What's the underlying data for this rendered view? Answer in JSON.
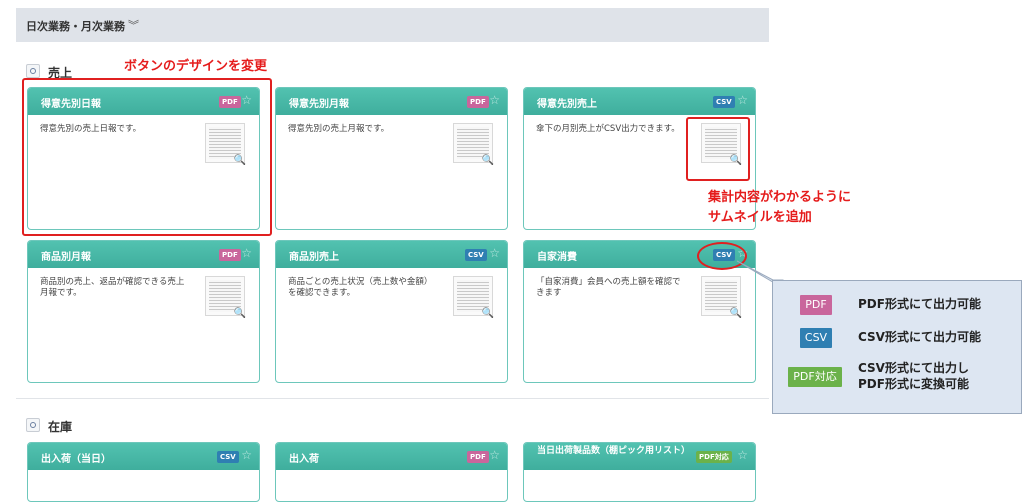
{
  "header": {
    "title": "日次業務・月次業務",
    "chevron_icon": "double-chevron-down-icon"
  },
  "sections": [
    {
      "title": "売上",
      "cards": [
        {
          "title": "得意先別日報",
          "badge": "PDF",
          "description": "得意先別の売上日報です。"
        },
        {
          "title": "得意先別月報",
          "badge": "PDF",
          "description": "得意先別の売上月報です。"
        },
        {
          "title": "得意先別売上",
          "badge": "CSV",
          "description": "傘下の月別売上がCSV出力できます。"
        },
        {
          "title": "商品別月報",
          "badge": "PDF",
          "description": "商品別の売上、返品が確認できる売上月報です。"
        },
        {
          "title": "商品別売上",
          "badge": "CSV",
          "description": "商品ごとの売上状況（売上数や金額）を確認できます。"
        },
        {
          "title": "自家消費",
          "badge": "CSV",
          "description": "「自家消費」会員への売上額を確認できます"
        }
      ]
    },
    {
      "title": "在庫",
      "cards": [
        {
          "title": "出入荷（当日）",
          "badge": "CSV"
        },
        {
          "title": "出入荷",
          "badge": "PDF"
        },
        {
          "title": "当日出荷製品数（棚ピック用リスト）",
          "badge": "PDF対応"
        }
      ]
    }
  ],
  "annotations": {
    "button_design": "ボタンのデザインを変更",
    "thumbnail_line1": "集計内容がわかるように",
    "thumbnail_line2": "サムネイルを追加"
  },
  "legend": [
    {
      "badge": "PDF",
      "text": "PDF形式にて出力可能"
    },
    {
      "badge": "CSV",
      "text": "CSV形式にて出力可能"
    },
    {
      "badge": "PDF対応",
      "text_line1": "CSV形式にて出力し",
      "text_line2": "PDF形式に変換可能"
    }
  ],
  "colors": {
    "card_header": "#46b6a4",
    "pdf_badge": "#c9669c",
    "csv_badge": "#2f7fb2",
    "pdf_convert_badge": "#6bb24a",
    "annotation_red": "#e02020"
  }
}
